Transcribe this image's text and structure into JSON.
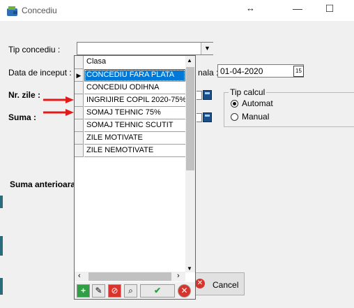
{
  "window": {
    "title": "Concediu",
    "resize_glyph": "↔",
    "minimize_glyph": "—",
    "maximize_glyph": "☐"
  },
  "form": {
    "tip_concediu_label": "Tip concediu :",
    "tip_concediu_value": "",
    "data_inceput_label": "Data de inceput :",
    "data_finala_label_partial": "nala :",
    "data_finala_value": "01-04-2020",
    "nr_zile_label": "Nr. zile :",
    "suma_label": "Suma :",
    "suma_anterioara_label": "Suma anterioara",
    "tip_calcul_title": "Tip calcul",
    "radio_automat": "Automat",
    "radio_manual": "Manual",
    "cancel_label": "Cancel"
  },
  "dropdown": {
    "header": "Clasa",
    "rows": [
      {
        "label": "CONCEDIU FARA PLATA",
        "selected": true
      },
      {
        "label": "CONCEDIU ODIHNA",
        "selected": false
      },
      {
        "label": "INGRIJIRE COPIL 2020-75%",
        "selected": false
      },
      {
        "label": "SOMAJ TEHNIC 75%",
        "selected": false
      },
      {
        "label": "SOMAJ TEHNIC SCUTIT",
        "selected": false
      },
      {
        "label": "ZILE MOTIVATE",
        "selected": false
      },
      {
        "label": "ZILE NEMOTIVATE",
        "selected": false
      }
    ],
    "nav_buttons": [
      "add",
      "edit",
      "delete",
      "search",
      "confirm",
      "cancel"
    ]
  },
  "colors": {
    "selection": "#0078d7",
    "arrow_red": "#e31a1a",
    "add_green": "#2ea043"
  }
}
